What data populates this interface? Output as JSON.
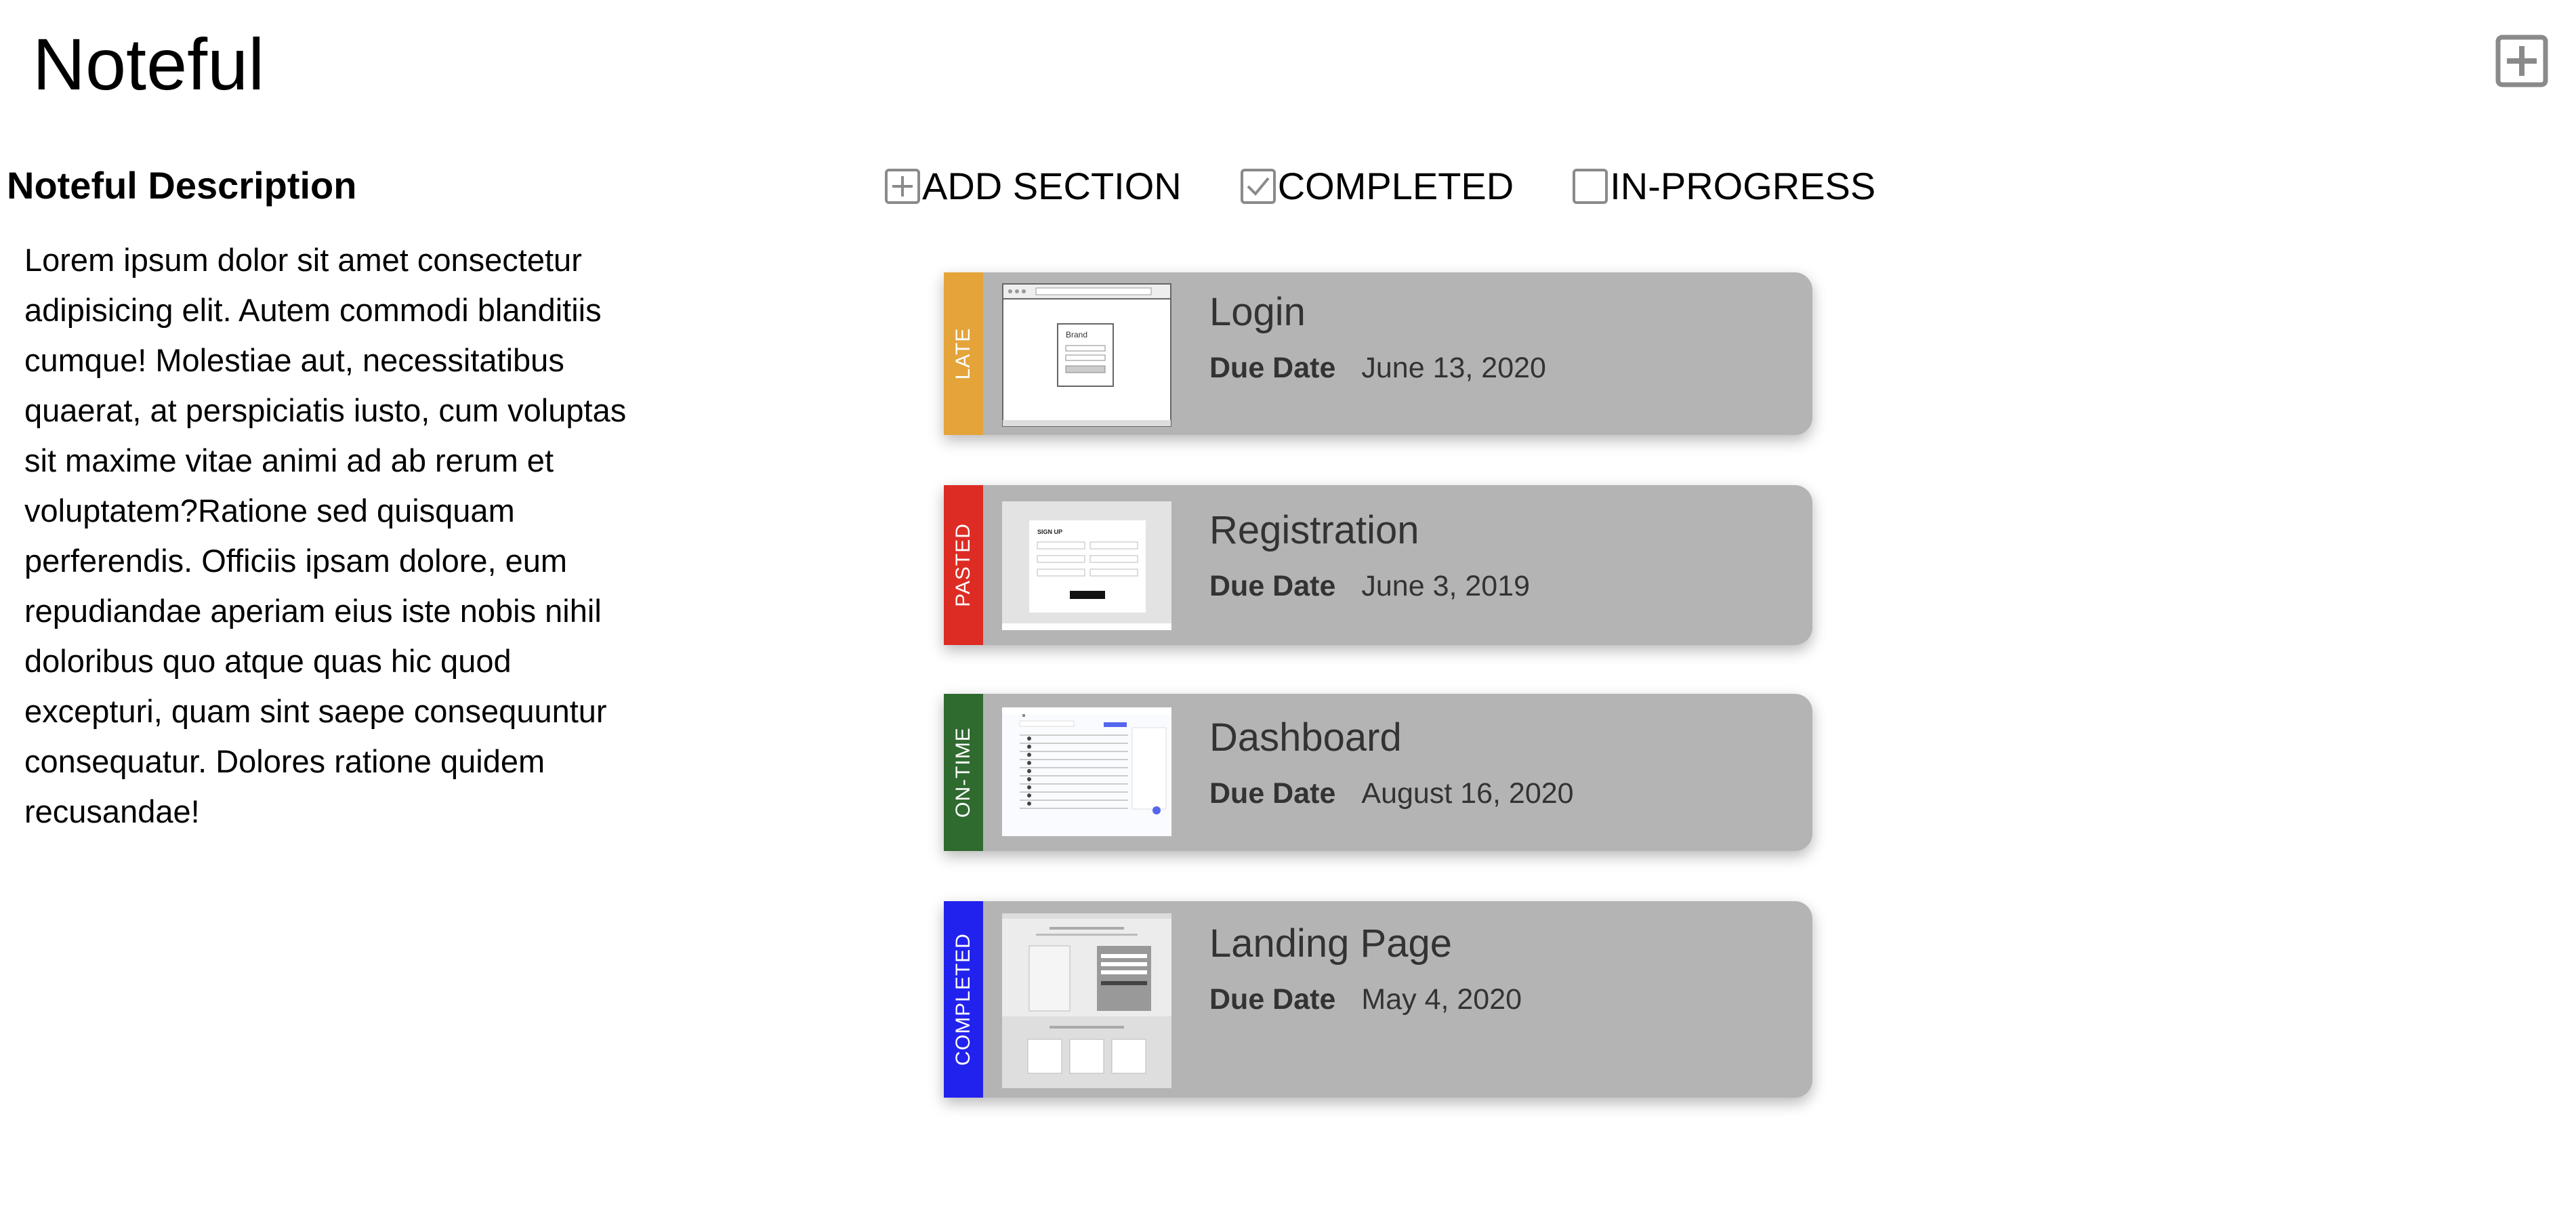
{
  "app": {
    "title": "Noteful"
  },
  "sidebar": {
    "heading": "Noteful Description",
    "body": "Lorem ipsum dolor sit amet consectetur adipisicing elit. Autem commodi blanditiis cumque! Molestiae aut, necessitatibus quaerat, at perspiciatis iusto, cum voluptas sit maxime vitae animi ad ab rerum et voluptatem?Ratione sed quisquam perferendis. Officiis ipsam dolore, eum repudiandae aperiam eius iste nobis nihil doloribus quo atque quas hic quod excepturi, quam sint saepe consequuntur consequatur. Dolores ratione quidem recusandae!"
  },
  "toolbar": {
    "add_section_label": "ADD SECTION",
    "completed_label": "COMPLETED",
    "completed_checked": true,
    "in_progress_label": "IN-PROGRESS",
    "in_progress_checked": false
  },
  "due_label": "Due Date",
  "cards": [
    {
      "status": "LATE",
      "status_color": "#e4a43a",
      "title": "Login",
      "due_date": "June 13, 2020",
      "thumb": "login-wireframe"
    },
    {
      "status": "PASTED",
      "status_color": "#dd2c24",
      "title": "Registration",
      "due_date": "June 3, 2019",
      "thumb": "signup-form"
    },
    {
      "status": "ON-TIME",
      "status_color": "#2f6a2f",
      "title": "Dashboard",
      "due_date": "August 16, 2020",
      "thumb": "dashboard-table"
    },
    {
      "status": "COMPLETED",
      "status_color": "#2222ee",
      "title": "Landing Page",
      "due_date": "May 4, 2020",
      "thumb": "landing-page-mockup"
    }
  ],
  "thumb_text": {
    "login_brand": "Brand",
    "signup_heading": "SIGN UP"
  },
  "colors": {
    "card_background": "#b5b4b4",
    "icon_gray": "#8a8a8a"
  }
}
